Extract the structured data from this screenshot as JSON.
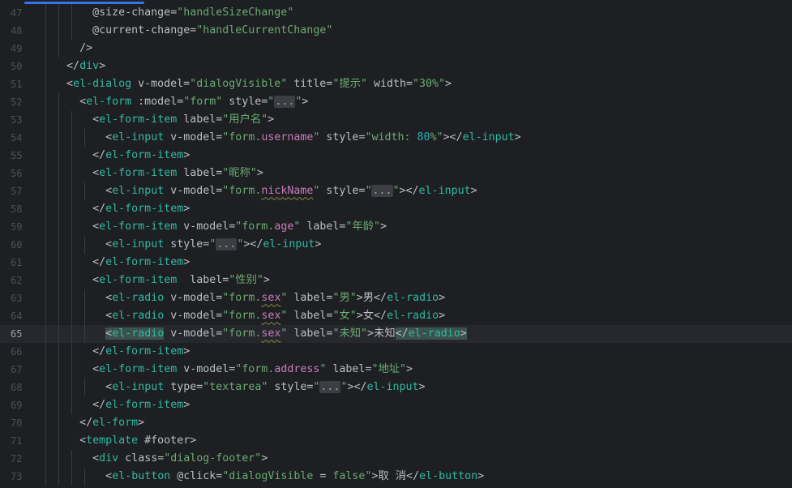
{
  "editor": {
    "lines": [
      {
        "n": "47",
        "indent": 8,
        "segs": [
          [
            "attr",
            "@size-change="
          ],
          [
            "str",
            "\"handleSizeChange\""
          ]
        ]
      },
      {
        "n": "48",
        "indent": 8,
        "segs": [
          [
            "attr",
            "@current-change="
          ],
          [
            "str",
            "\"handleCurrentChange\""
          ]
        ]
      },
      {
        "n": "49",
        "indent": 6,
        "segs": [
          [
            "punct",
            "/>"
          ]
        ]
      },
      {
        "n": "50",
        "indent": 4,
        "segs": [
          [
            "punct",
            "</"
          ],
          [
            "tag-el",
            "div"
          ],
          [
            "punct",
            ">"
          ]
        ]
      },
      {
        "n": "51",
        "indent": 4,
        "segs": [
          [
            "punct",
            "<"
          ],
          [
            "tag-el",
            "el-dialog"
          ],
          [
            "attr",
            " v-model="
          ],
          [
            "str",
            "\"dialogVisible\""
          ],
          [
            "attr",
            " title="
          ],
          [
            "str",
            "\"提示\""
          ],
          [
            "attr",
            " width="
          ],
          [
            "str",
            "\"30%\""
          ],
          [
            "punct",
            ">"
          ]
        ]
      },
      {
        "n": "52",
        "indent": 6,
        "segs": [
          [
            "punct",
            "<"
          ],
          [
            "tag-el",
            "el-form"
          ],
          [
            "attr",
            " :model="
          ],
          [
            "str",
            "\"form\""
          ],
          [
            "attr",
            " style="
          ],
          [
            "str",
            "\""
          ],
          [
            "fold",
            "..."
          ],
          [
            "str",
            "\""
          ],
          [
            "punct",
            ">"
          ]
        ]
      },
      {
        "n": "53",
        "indent": 8,
        "segs": [
          [
            "punct",
            "<"
          ],
          [
            "tag-el",
            "el-form-item"
          ],
          [
            "attr",
            " label="
          ],
          [
            "str",
            "\"用户名\""
          ],
          [
            "punct",
            ">"
          ]
        ]
      },
      {
        "n": "54",
        "indent": 10,
        "segs": [
          [
            "punct",
            "<"
          ],
          [
            "tag-el",
            "el-input"
          ],
          [
            "attr",
            " v-model="
          ],
          [
            "str",
            "\"form."
          ],
          [
            "str-b",
            "username"
          ],
          [
            "str",
            "\""
          ],
          [
            "attr",
            " style="
          ],
          [
            "str",
            "\"width: "
          ],
          [
            "num",
            "80"
          ],
          [
            "str",
            "%\""
          ],
          [
            "punct",
            "></"
          ],
          [
            "tag-el",
            "el-input"
          ],
          [
            "punct",
            ">"
          ]
        ]
      },
      {
        "n": "55",
        "indent": 8,
        "segs": [
          [
            "punct",
            "</"
          ],
          [
            "tag-el",
            "el-form-item"
          ],
          [
            "punct",
            ">"
          ]
        ]
      },
      {
        "n": "56",
        "indent": 8,
        "segs": [
          [
            "punct",
            "<"
          ],
          [
            "tag-el",
            "el-form-item"
          ],
          [
            "attr",
            " label="
          ],
          [
            "str",
            "\"昵称\""
          ],
          [
            "punct",
            ">"
          ]
        ]
      },
      {
        "n": "57",
        "indent": 10,
        "segs": [
          [
            "punct",
            "<"
          ],
          [
            "tag-el",
            "el-input"
          ],
          [
            "attr",
            " v-model="
          ],
          [
            "str",
            "\"form."
          ],
          [
            "squig",
            "nickName"
          ],
          [
            "str",
            "\""
          ],
          [
            "attr",
            " style="
          ],
          [
            "str",
            "\""
          ],
          [
            "fold",
            "..."
          ],
          [
            "str",
            "\""
          ],
          [
            "punct",
            "></"
          ],
          [
            "tag-el",
            "el-input"
          ],
          [
            "punct",
            ">"
          ]
        ]
      },
      {
        "n": "58",
        "indent": 8,
        "segs": [
          [
            "punct",
            "</"
          ],
          [
            "tag-el",
            "el-form-item"
          ],
          [
            "punct",
            ">"
          ]
        ]
      },
      {
        "n": "59",
        "indent": 8,
        "segs": [
          [
            "punct",
            "<"
          ],
          [
            "tag-el",
            "el-form-item"
          ],
          [
            "attr",
            " v-model="
          ],
          [
            "str",
            "\"form."
          ],
          [
            "str-b",
            "age"
          ],
          [
            "str",
            "\""
          ],
          [
            "attr",
            " label="
          ],
          [
            "str",
            "\"年龄\""
          ],
          [
            "punct",
            ">"
          ]
        ]
      },
      {
        "n": "60",
        "indent": 10,
        "segs": [
          [
            "punct",
            "<"
          ],
          [
            "tag-el",
            "el-input"
          ],
          [
            "attr",
            " style="
          ],
          [
            "str",
            "\""
          ],
          [
            "fold",
            "..."
          ],
          [
            "str",
            "\""
          ],
          [
            "punct",
            "></"
          ],
          [
            "tag-el",
            "el-input"
          ],
          [
            "punct",
            ">"
          ]
        ]
      },
      {
        "n": "61",
        "indent": 8,
        "segs": [
          [
            "punct",
            "</"
          ],
          [
            "tag-el",
            "el-form-item"
          ],
          [
            "punct",
            ">"
          ]
        ]
      },
      {
        "n": "62",
        "indent": 8,
        "segs": [
          [
            "punct",
            "<"
          ],
          [
            "tag-el",
            "el-form-item"
          ],
          [
            "attr",
            "  label="
          ],
          [
            "str",
            "\"性别\""
          ],
          [
            "punct",
            ">"
          ]
        ]
      },
      {
        "n": "63",
        "indent": 10,
        "segs": [
          [
            "punct",
            "<"
          ],
          [
            "tag-el",
            "el-radio"
          ],
          [
            "attr",
            " v-model="
          ],
          [
            "str",
            "\"form."
          ],
          [
            "squig",
            "sex"
          ],
          [
            "str",
            "\""
          ],
          [
            "attr",
            " label="
          ],
          [
            "str",
            "\"男\""
          ],
          [
            "punct",
            ">男</"
          ],
          [
            "tag-el",
            "el-radio"
          ],
          [
            "punct",
            ">"
          ]
        ]
      },
      {
        "n": "64",
        "indent": 10,
        "segs": [
          [
            "punct",
            "<"
          ],
          [
            "tag-el",
            "el-radio"
          ],
          [
            "attr",
            " v-model="
          ],
          [
            "str",
            "\"form."
          ],
          [
            "squig",
            "sex"
          ],
          [
            "str",
            "\""
          ],
          [
            "attr",
            " label="
          ],
          [
            "str",
            "\"女\""
          ],
          [
            "punct",
            ">女</"
          ],
          [
            "tag-el",
            "el-radio"
          ],
          [
            "punct",
            ">"
          ]
        ]
      },
      {
        "n": "65",
        "indent": 10,
        "current": true,
        "segs": [
          [
            "hl",
            "<"
          ],
          [
            "hltag",
            "el-radio"
          ],
          [
            "attr",
            " v-model="
          ],
          [
            "str",
            "\"form."
          ],
          [
            "squig",
            "sex"
          ],
          [
            "str",
            "\""
          ],
          [
            "attr",
            " label="
          ],
          [
            "str",
            "\"未知\""
          ],
          [
            "punct",
            ">未知"
          ],
          [
            "hl",
            "</"
          ],
          [
            "hltag",
            "el-radio"
          ],
          [
            "hl",
            ">"
          ]
        ]
      },
      {
        "n": "66",
        "indent": 8,
        "segs": [
          [
            "punct",
            "</"
          ],
          [
            "tag-el",
            "el-form-item"
          ],
          [
            "punct",
            ">"
          ]
        ]
      },
      {
        "n": "67",
        "indent": 8,
        "segs": [
          [
            "punct",
            "<"
          ],
          [
            "tag-el",
            "el-form-item"
          ],
          [
            "attr",
            " v-model="
          ],
          [
            "str",
            "\"form."
          ],
          [
            "str-b",
            "address"
          ],
          [
            "str",
            "\""
          ],
          [
            "attr",
            " label="
          ],
          [
            "str",
            "\"地址\""
          ],
          [
            "punct",
            ">"
          ]
        ]
      },
      {
        "n": "68",
        "indent": 10,
        "segs": [
          [
            "punct",
            "<"
          ],
          [
            "tag-el",
            "el-input"
          ],
          [
            "attr",
            " type="
          ],
          [
            "str",
            "\"textarea\""
          ],
          [
            "attr",
            " style="
          ],
          [
            "str",
            "\""
          ],
          [
            "fold",
            "..."
          ],
          [
            "str",
            "\""
          ],
          [
            "punct",
            "></"
          ],
          [
            "tag-el",
            "el-input"
          ],
          [
            "punct",
            ">"
          ]
        ]
      },
      {
        "n": "69",
        "indent": 8,
        "segs": [
          [
            "punct",
            "</"
          ],
          [
            "tag-el",
            "el-form-item"
          ],
          [
            "punct",
            ">"
          ]
        ]
      },
      {
        "n": "70",
        "indent": 6,
        "segs": [
          [
            "punct",
            "</"
          ],
          [
            "tag-el",
            "el-form"
          ],
          [
            "punct",
            ">"
          ]
        ]
      },
      {
        "n": "71",
        "indent": 6,
        "segs": [
          [
            "punct",
            "<"
          ],
          [
            "tag-el",
            "template"
          ],
          [
            "attr",
            " #footer"
          ],
          [
            "punct",
            ">"
          ]
        ]
      },
      {
        "n": "72",
        "indent": 8,
        "segs": [
          [
            "punct",
            "<"
          ],
          [
            "tag-el",
            "div"
          ],
          [
            "attr",
            " class="
          ],
          [
            "str",
            "\"dialog-footer\""
          ],
          [
            "punct",
            ">"
          ]
        ]
      },
      {
        "n": "73",
        "indent": 10,
        "segs": [
          [
            "punct",
            "<"
          ],
          [
            "tag-el",
            "el-button"
          ],
          [
            "attr",
            " @click="
          ],
          [
            "str",
            "\"dialogVisible"
          ],
          [
            "attr",
            " = "
          ],
          [
            "str",
            "false\""
          ],
          [
            "punct",
            ">取 消</"
          ],
          [
            "tag-el",
            "el-button"
          ],
          [
            "punct",
            ">"
          ]
        ]
      }
    ]
  },
  "colors": {
    "background": "#1e1f22",
    "current_line": "#26282e",
    "tag": "#2fbaa3",
    "string": "#6aab73",
    "number": "#2aacb8",
    "text": "#bcbec4",
    "line_number": "#4b5059",
    "accent": "#3574f0"
  }
}
